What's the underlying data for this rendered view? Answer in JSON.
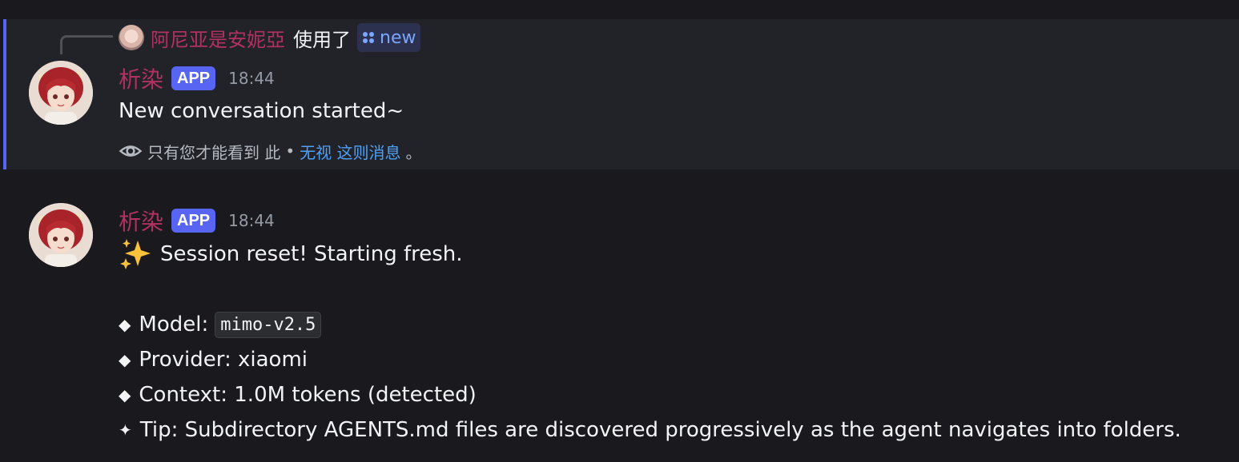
{
  "reply": {
    "user": "阿尼亚是安妮亞",
    "action": "使用了",
    "command": "new"
  },
  "messages": [
    {
      "username": "析染",
      "badge": "APP",
      "time": "18:44",
      "text": "New conversation started~",
      "ephemeral": {
        "notice": "只有您才能看到 此",
        "separator": "•",
        "dismiss": "无视 这则消息",
        "end": "。"
      }
    },
    {
      "username": "析染",
      "badge": "APP",
      "time": "18:44",
      "emoji": "sparkles",
      "lines": {
        "session": "Session reset! Starting fresh.",
        "model_label": "Model:",
        "model_value": "mimo-v2.5",
        "provider": "Provider: xiaomi",
        "context": "Context: 1.0M tokens (detected)",
        "tip": "Tip: Subdirectory AGENTS.md files are discovered progressively as the agent navigates into folders."
      },
      "bullet": "◆",
      "tip_bullet": "✦"
    }
  ],
  "colors": {
    "background": "#1a1a1e",
    "ephemeral_bg": "#222229",
    "accent": "#5865f2",
    "username": "#b13260",
    "link": "#4ea1f8"
  }
}
